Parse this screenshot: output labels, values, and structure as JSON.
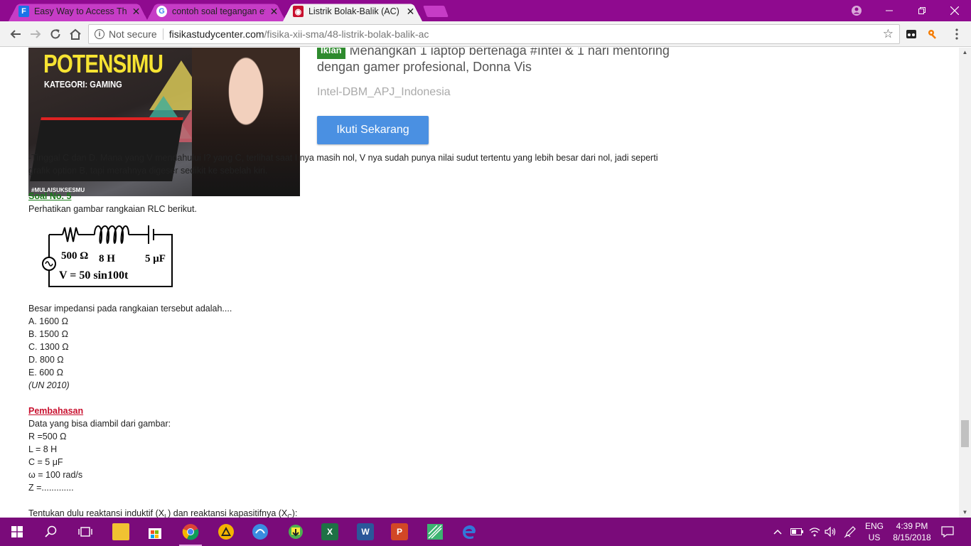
{
  "browser": {
    "tabs": [
      {
        "title": "Easy Way to Access The I",
        "favicon": "F",
        "favicon_color": "#1a73e8",
        "close": "✕"
      },
      {
        "title": "contoh soal tegangan efe",
        "favicon": "G",
        "favicon_color": "#ffffff",
        "close": "✕"
      },
      {
        "title": "Listrik Bolak-Balik (AC)",
        "favicon": "◉",
        "favicon_color": "#c8102e",
        "close": "✕"
      }
    ],
    "address": {
      "security": "Not secure",
      "host": "fisikastudycenter.com",
      "path": "/fisika-xii-sma/48-listrik-bolak-balik-ac"
    }
  },
  "ad": {
    "image_headline": "POTENSIMU",
    "image_category": "KATEGORI: GAMING",
    "image_hashtag": "#MULAISUKSESMU",
    "badge": "Iklan",
    "text_line1": "Menangkan 1 laptop bertenaga #Intel & 1 hari mentoring",
    "text_line2": "dengan gamer profesional, Donna Vis",
    "sponsor": "Intel-DBM_APJ_Indonesia",
    "cta": "Ikuti Sekarang"
  },
  "article": {
    "p1_line1": "-Tinggal C dan D. Mana yang V mendahului I? yang C, terlihat saat I nya masih nol, V nya sudah punya nilai sudut tertentu yang lebih besar dari nol, jadi seperti",
    "p1_line2": "grafik option B, tapi merahnya digeser sedikit ke sebelah kiri.",
    "soal_heading": "Soal No. 5",
    "soal_intro": "Perhatikan gambar rangkaian RLC berikut.",
    "circuit": {
      "r": "500 Ω",
      "l": "8 H",
      "c": "5 μF",
      "v": "V = 50 sin100t"
    },
    "question": "Besar impedansi pada rangkaian tersebut adalah....",
    "options": [
      "A. 1600 Ω",
      "B. 1500 Ω",
      "C. 1300 Ω",
      "D. 800 Ω",
      "E. 600 Ω"
    ],
    "source": "(UN 2010)",
    "pembahasan_heading": "Pembahasan",
    "data_intro": "Data yang bisa diambil dari gambar:",
    "data": [
      "R =500 Ω",
      "L = 8 H",
      "C = 5 μF",
      "ω = 100 rad/s",
      "Z =............."
    ],
    "next_line": "Tentukan dulu reaktansi induktif (X",
    "next_line_sub1": "L",
    "next_line_mid": ") dan reaktansi kapasitifnya (X",
    "next_line_sub2": "C",
    "next_line_end": "):"
  },
  "taskbar": {
    "lang_top": "ENG",
    "lang_bottom": "US",
    "time": "4:39 PM",
    "date": "8/15/2018"
  }
}
